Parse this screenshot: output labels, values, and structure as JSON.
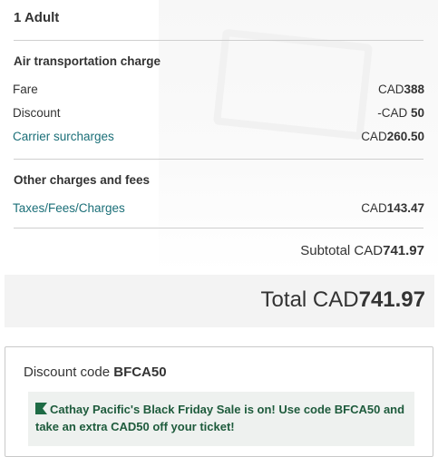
{
  "passenger": {
    "label": "1 Adult"
  },
  "air_section": {
    "title": "Air transportation charge",
    "rows": [
      {
        "label": "Fare",
        "currency": "CAD",
        "amount": "388",
        "link": false
      },
      {
        "label": "Discount",
        "currency": "-CAD ",
        "amount": "50",
        "link": false
      },
      {
        "label": "Carrier surcharges",
        "currency": "CAD",
        "amount": "260.50",
        "link": true
      }
    ]
  },
  "other_section": {
    "title": "Other charges and fees",
    "rows": [
      {
        "label": "Taxes/Fees/Charges",
        "currency": "CAD",
        "amount": "143.47",
        "link": true
      }
    ]
  },
  "subtotal": {
    "label": "Subtotal CAD",
    "amount": "741.97"
  },
  "total": {
    "label": "Total CAD",
    "amount": "741.97"
  },
  "discount": {
    "label": "Discount code ",
    "code": "BFCA50",
    "promo_text": "Cathay Pacific's Black Friday Sale is on! Use code BFCA50 and take an extra CAD50 off your ticket!"
  },
  "colors": {
    "link": "#1b6f78",
    "promo_text": "#1e5b3c",
    "promo_bg": "#eef1ef",
    "total_bg": "#f3f3f3"
  },
  "icons": {
    "promo": "flag-icon"
  }
}
